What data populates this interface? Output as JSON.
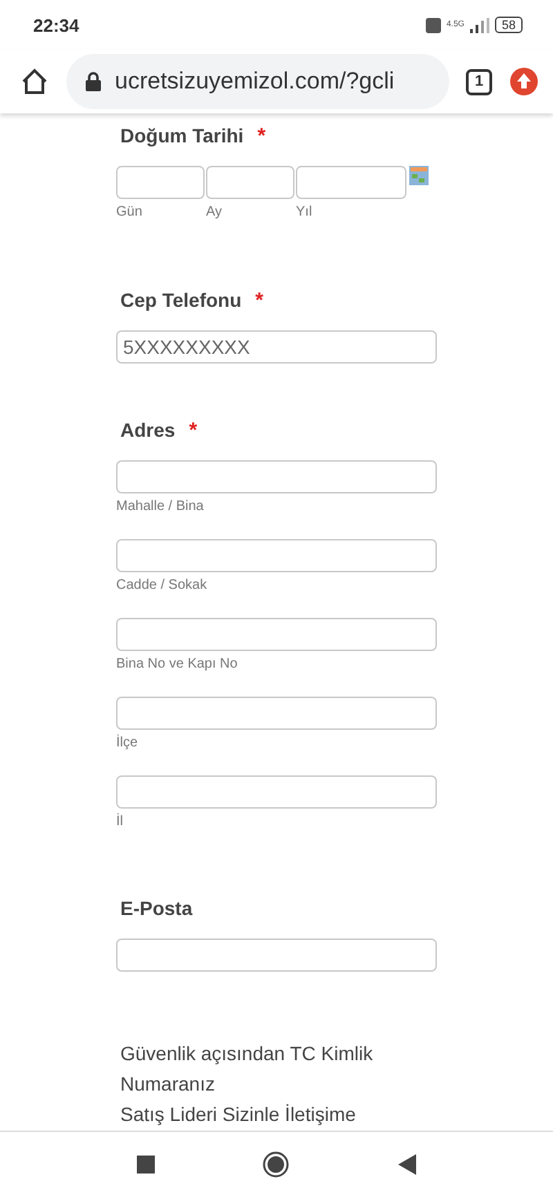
{
  "status_bar": {
    "time": "22:34",
    "network": "4.5G",
    "battery": "58"
  },
  "browser": {
    "url": "ucretsizuyemizol.com/?gcli",
    "tab_count": "1"
  },
  "form": {
    "date_field": {
      "label": "Doğum Tarihi",
      "required_mark": "*",
      "parts": [
        "Gün",
        "Ay",
        "Yıl"
      ]
    },
    "phone_field": {
      "label": "Cep Telefonu",
      "required_mark": "*",
      "placeholder": "5XXXXXXXXX"
    },
    "address_field": {
      "label": "Adres",
      "required_mark": "*",
      "parts": [
        "Mahalle / Bina",
        "Cadde / Sokak",
        "Bina No ve Kapı No",
        "İlçe",
        "İl"
      ]
    },
    "email_field": {
      "label": "E-Posta"
    },
    "notes": [
      "Güvenlik açısından TC Kimlik Numaranız",
      "Satış Lideri Sizinle İletişime"
    ]
  }
}
